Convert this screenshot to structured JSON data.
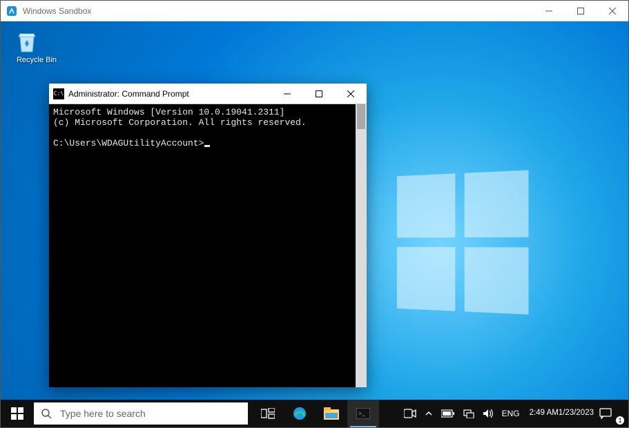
{
  "outer_window": {
    "title": "Windows Sandbox"
  },
  "desktop": {
    "recycle_bin_label": "Recycle Bin"
  },
  "cmd": {
    "title": "Administrator: Command Prompt",
    "icon_text": "C:\\",
    "line1": "Microsoft Windows [Version 10.0.19041.2311]",
    "line2": "(c) Microsoft Corporation. All rights reserved.",
    "prompt": "C:\\Users\\WDAGUtilityAccount>"
  },
  "taskbar": {
    "search_placeholder": "Type here to search",
    "lang": "ENG",
    "time": "2:49 AM",
    "date": "1/23/2023",
    "action_center_count": "1"
  }
}
